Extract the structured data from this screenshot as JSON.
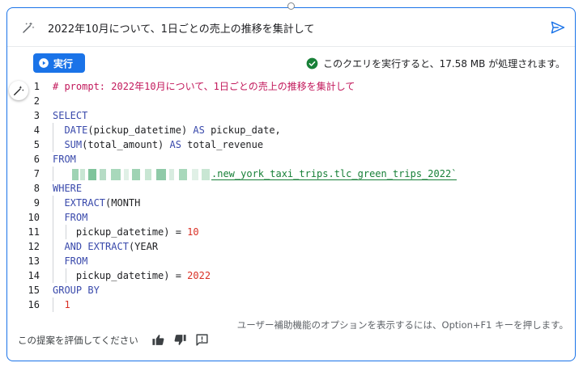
{
  "prompt": {
    "text": "2022年10月について、1日ごとの売上の推移を集計して"
  },
  "toolbar": {
    "run_label": "実行",
    "validation_message": "このクエリを実行すると、17.58 MB が処理されます。"
  },
  "editor": {
    "lines": [
      {
        "n": "1",
        "parts": [
          {
            "t": "# prompt: 2022年10月について、1日ごとの売上の推移を集計して",
            "c": "comment"
          }
        ]
      },
      {
        "n": "2",
        "parts": []
      },
      {
        "n": "3",
        "parts": [
          {
            "t": "SELECT",
            "c": "kw"
          }
        ]
      },
      {
        "n": "4",
        "parts": [
          {
            "t": "  DATE",
            "c": "fn"
          },
          {
            "t": "(pickup_datetime) ",
            "c": "id"
          },
          {
            "t": "AS",
            "c": "kw"
          },
          {
            "t": " pickup_date,",
            "c": "id"
          }
        ]
      },
      {
        "n": "5",
        "parts": [
          {
            "t": "  SUM",
            "c": "fn"
          },
          {
            "t": "(total_amount) ",
            "c": "id"
          },
          {
            "t": "AS",
            "c": "kw"
          },
          {
            "t": " total_revenue",
            "c": "id"
          }
        ]
      },
      {
        "n": "6",
        "parts": [
          {
            "t": "FROM",
            "c": "kw"
          }
        ]
      },
      {
        "n": "7",
        "parts": [
          {
            "t": ".new_york_taxi_trips.tlc_green_trips_2022`",
            "c": "tbl"
          }
        ],
        "redacted": true
      },
      {
        "n": "8",
        "parts": [
          {
            "t": "WHERE",
            "c": "kw"
          }
        ]
      },
      {
        "n": "9",
        "parts": [
          {
            "t": "  EXTRACT",
            "c": "fn"
          },
          {
            "t": "(MONTH",
            "c": "id"
          }
        ]
      },
      {
        "n": "10",
        "parts": [
          {
            "t": "  FROM",
            "c": "kw"
          }
        ]
      },
      {
        "n": "11",
        "parts": [
          {
            "t": "    pickup_datetime) = ",
            "c": "id"
          },
          {
            "t": "10",
            "c": "num"
          }
        ]
      },
      {
        "n": "12",
        "parts": [
          {
            "t": "  AND ",
            "c": "kw"
          },
          {
            "t": "EXTRACT",
            "c": "fn"
          },
          {
            "t": "(YEAR",
            "c": "id"
          }
        ]
      },
      {
        "n": "13",
        "parts": [
          {
            "t": "  FROM",
            "c": "kw"
          }
        ]
      },
      {
        "n": "14",
        "parts": [
          {
            "t": "    pickup_datetime) = ",
            "c": "id"
          },
          {
            "t": "2022",
            "c": "num"
          }
        ]
      },
      {
        "n": "15",
        "parts": [
          {
            "t": "GROUP BY",
            "c": "kw"
          }
        ]
      },
      {
        "n": "16",
        "parts": [
          {
            "t": "  1",
            "c": "num"
          }
        ]
      }
    ]
  },
  "accessibility_hint": "ユーザー補助機能のオプションを表示するには、Option+F1 キーを押します。",
  "feedback": {
    "label": "この提案を評価してください"
  },
  "icons": {
    "prompt": "magic-wand-icon",
    "send": "send-icon",
    "run": "play-circle-icon",
    "validation": "check-circle-icon",
    "gutter": "magic-wand-icon",
    "thumbs_up": "thumbs-up-icon",
    "thumbs_down": "thumbs-down-icon",
    "report": "report-icon"
  },
  "colors": {
    "accent": "#1a73e8",
    "success": "#188038",
    "comment": "#c2185b",
    "keyword": "#3949ab",
    "number": "#d93025"
  }
}
